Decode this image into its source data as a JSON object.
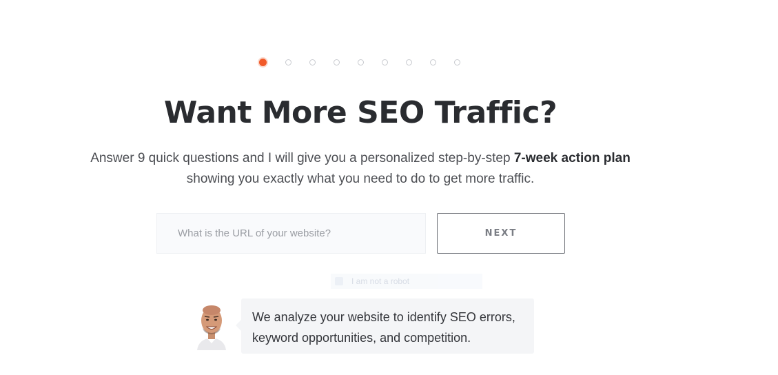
{
  "progress": {
    "total_steps": 9,
    "current_step": 1
  },
  "headline": "Want More SEO Traffic?",
  "subtitle": {
    "text_before": "Answer 9 quick questions and I will give you a personalized step-by-step ",
    "emphasis": "7-week action plan",
    "text_after": " showing you exactly what you need to do to get more traffic."
  },
  "form": {
    "url_placeholder": "What is the URL of your website?",
    "url_value": "",
    "next_label": "NEXT"
  },
  "faint_overlay": {
    "text": "I am not a robot"
  },
  "bubble": {
    "text": "We analyze your website to identify SEO errors, keyword opportunities, and competition."
  },
  "colors": {
    "accent": "#f15a29",
    "text_dark": "#2a2c30",
    "bubble_bg": "#f4f5f7"
  }
}
